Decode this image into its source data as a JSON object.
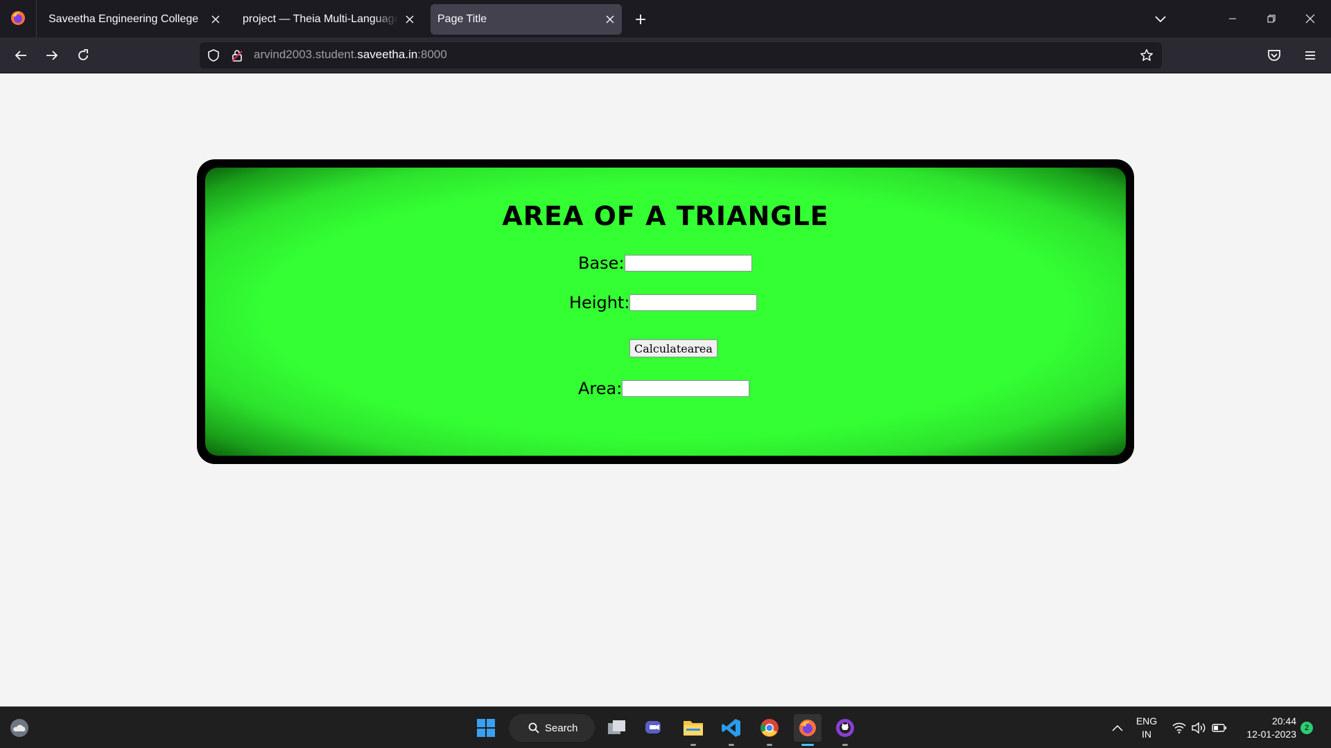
{
  "browser": {
    "tabs": [
      {
        "label": "Saveetha Engineering College",
        "active": false
      },
      {
        "label": "project — Theia Multi-Language Ex",
        "active": false
      },
      {
        "label": "Page Title",
        "active": true
      }
    ],
    "url": {
      "prefix": "arvind2003.student.",
      "domain": "saveetha.in",
      "suffix": ":8000"
    },
    "icons": [
      "firefox-icon",
      "close-icon",
      "plus-icon",
      "chevron-down-icon",
      "minimize-icon",
      "restore-icon",
      "back-icon",
      "forward-icon",
      "reload-icon",
      "shield-icon",
      "lock-icon",
      "star-icon",
      "pocket-icon",
      "menu-icon"
    ]
  },
  "page": {
    "title": "AREA OF A TRIANGLE",
    "base_label": "Base:",
    "height_label": "Height:",
    "area_label": "Area:",
    "base_value": "",
    "height_value": "",
    "area_value": "",
    "button_label": "Calculatearea",
    "colors": {
      "panel": "#33ff33",
      "frame": "#000000"
    }
  },
  "taskbar": {
    "search_label": "Search",
    "lang_line1": "ENG",
    "lang_line2": "IN",
    "time": "20:44",
    "date": "12-01-2023",
    "notification_count": "2"
  }
}
